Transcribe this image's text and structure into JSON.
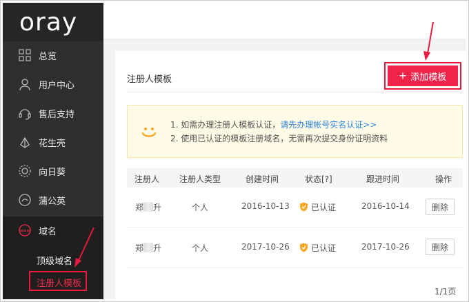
{
  "sidebar": {
    "logo": "oray",
    "items": [
      {
        "label": "总览",
        "icon": "grid-icon"
      },
      {
        "label": "用户中心",
        "icon": "user-icon"
      },
      {
        "label": "售后支持",
        "icon": "headset-icon"
      },
      {
        "label": "花生壳",
        "icon": "peanut-shell-icon"
      },
      {
        "label": "向日葵",
        "icon": "sunflower-icon"
      },
      {
        "label": "蒲公英",
        "icon": "dandelion-icon"
      },
      {
        "label": "域名",
        "icon": "www-icon"
      }
    ],
    "sub_items": [
      {
        "label": "顶级域名"
      },
      {
        "label": "注册人模板"
      }
    ]
  },
  "header": {
    "title": "注册人模板",
    "add_button": "添加模板"
  },
  "notice": {
    "line1_prefix": "1. 如需办理注册人模板认证，",
    "line1_link": "请先办理帐号实名认证>>",
    "line2": "2. 使用已认证的模板注册域名，无需再次提交身份证明资料"
  },
  "table": {
    "columns": [
      "注册人",
      "注册人类型",
      "创建时间",
      "状态[?]",
      "跟进时间",
      "操作"
    ],
    "rows": [
      {
        "name_first": "郑",
        "name_last": "升",
        "type": "个人",
        "created": "2016-10-13",
        "status": "已认证",
        "followed": "2016-10-14",
        "action": "删除"
      },
      {
        "name_first": "郑",
        "name_last": "升",
        "type": "个人",
        "created": "2017-10-26",
        "status": "已认证",
        "followed": "2017-10-26",
        "action": "删除"
      }
    ]
  },
  "pagination": {
    "text": "1/1页"
  },
  "colors": {
    "accent": "#f0234b",
    "sidebar_bg": "#2f2f2f",
    "link": "#2c87e0",
    "verified": "#f5a623"
  }
}
